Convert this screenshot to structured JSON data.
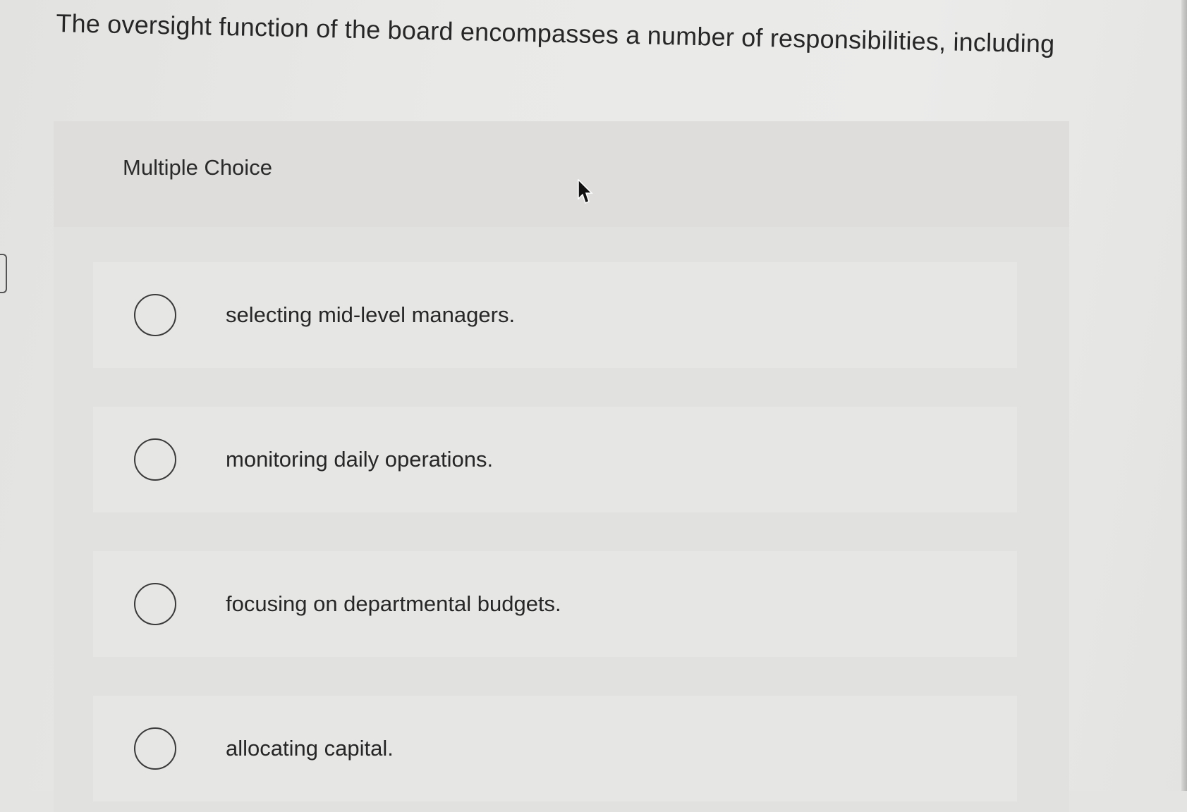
{
  "question": {
    "text": "The oversight function of the board encompasses a number of responsibilities, including"
  },
  "card": {
    "type_label": "Multiple Choice",
    "options": [
      {
        "label": "selecting mid-level managers."
      },
      {
        "label": "monitoring daily operations."
      },
      {
        "label": "focusing on departmental budgets."
      },
      {
        "label": "allocating capital."
      }
    ]
  }
}
